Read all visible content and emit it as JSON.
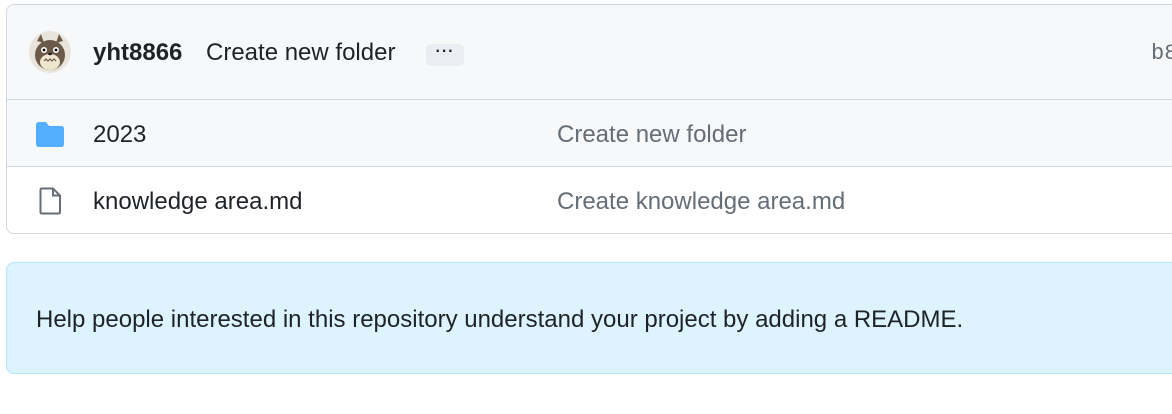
{
  "latest_commit": {
    "author": "yht8866",
    "message": "Create new folder",
    "more_label": "···",
    "sha": "b8"
  },
  "files": [
    {
      "type": "folder",
      "icon": "folder-icon",
      "name": "2023",
      "commit_message": "Create new folder"
    },
    {
      "type": "file",
      "icon": "file-icon",
      "name": "knowledge area.md",
      "commit_message": "Create knowledge area.md"
    }
  ],
  "readme_banner": {
    "text": "Help people interested in this repository understand your project by adding a README."
  },
  "colors": {
    "folder": "#54aeff",
    "banner_bg": "#ddf4ff",
    "header_bg": "#f6f8fa"
  }
}
